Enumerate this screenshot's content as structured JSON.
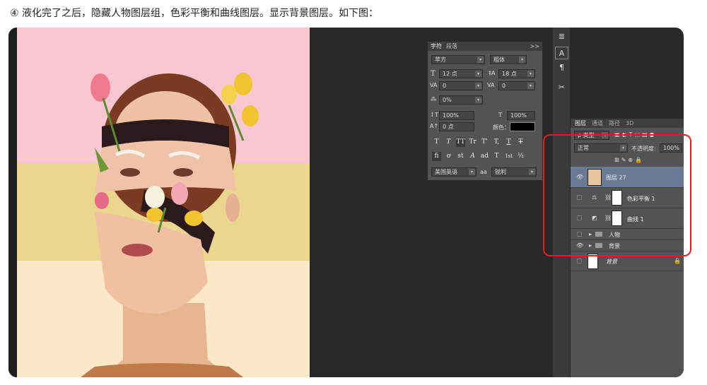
{
  "caption": "④ 液化完了之后，隐藏人物图层组，色彩平衡和曲线图层。显示背景图层。如下图：",
  "colors": {
    "highlight": "#e0201f",
    "layer_selected": "#6b7a94",
    "panel": "#535353"
  },
  "character_panel": {
    "tabs": [
      "字符",
      "段落"
    ],
    "menu_icon": ">>",
    "font_family": "苹方",
    "font_style": "粗体",
    "font_size": "12 点",
    "leading": "18 点",
    "kerning": "0",
    "tracking": "0",
    "tsume": "0%",
    "vertical_scale": "100%",
    "horizontal_scale": "100%",
    "baseline_shift": "0 点",
    "color_label": "颜色：",
    "style_buttons": [
      "T",
      "T",
      "TT",
      "Tr",
      "T'",
      "T,",
      "T",
      "T"
    ],
    "opentype_buttons": [
      "fi",
      "ơ",
      "st",
      "A",
      "ad",
      "T",
      "1st",
      "½"
    ],
    "language": "美国英语",
    "aa_label": "aa",
    "antialias": "锐利"
  },
  "tools": {
    "icons": [
      "paragraph-styles-icon",
      "character-panel-icon",
      "paragraph-icon",
      "tools-icon"
    ],
    "glyphs": [
      "≣",
      "A",
      "¶",
      "✂"
    ]
  },
  "layers_panel": {
    "tabs": [
      "图层",
      "通道",
      "路径",
      "3D"
    ],
    "filter_kind": "ρ 类型",
    "blend_mode": "正常",
    "opacity_label": "不透明度:",
    "opacity": "100%",
    "layers": [
      {
        "name": "图层 27",
        "visible": true,
        "selected": true,
        "type": "pixel"
      },
      {
        "name": "色彩平衡 1",
        "visible": false,
        "selected": false,
        "type": "adjustment",
        "icon": "balance-icon"
      },
      {
        "name": "曲线 1",
        "visible": false,
        "selected": false,
        "type": "adjustment",
        "icon": "curves-icon"
      },
      {
        "name": "人物",
        "visible": false,
        "selected": false,
        "type": "group"
      },
      {
        "name": "背景",
        "visible": true,
        "selected": false,
        "type": "group"
      },
      {
        "name": "背景",
        "visible": false,
        "selected": false,
        "type": "background",
        "locked": true
      }
    ]
  }
}
